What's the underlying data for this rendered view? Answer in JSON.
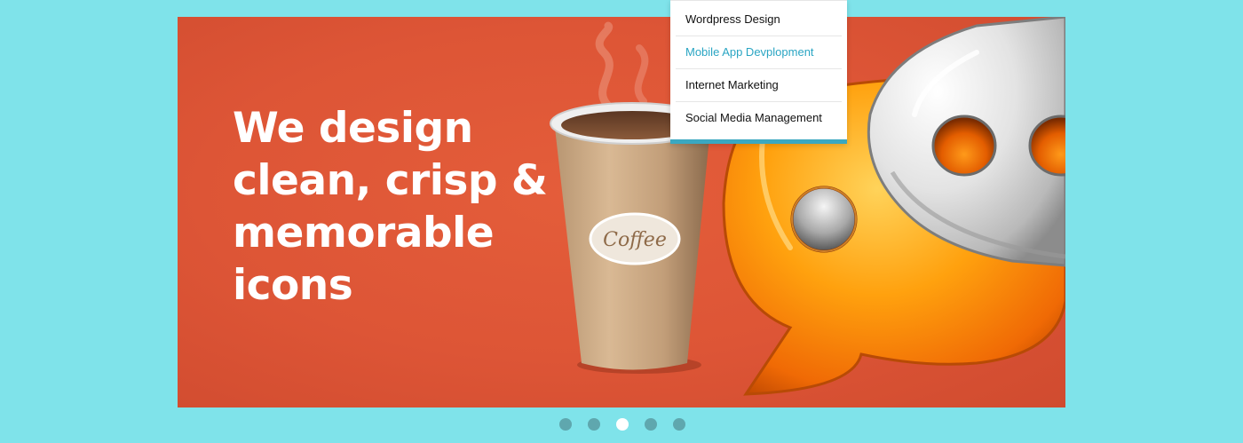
{
  "slider": {
    "headline_lines": [
      "We design",
      "clean, crisp &",
      "memorable",
      "icons"
    ],
    "coffee_label": "Coffee",
    "background_color": "#dd5536",
    "active_slide_index": 2,
    "slide_count": 5
  },
  "menu": {
    "items": [
      {
        "label": "Wordpress Design"
      },
      {
        "label": "Mobile App Devplopment"
      },
      {
        "label": "Internet Marketing"
      },
      {
        "label": "Social Media Management"
      }
    ],
    "active_item_index": 1,
    "accent_color": "#3aa8c1"
  },
  "colors": {
    "page_background": "#7fe3ea",
    "dot_inactive": "#5fa7ae",
    "dot_active": "#ffffff"
  }
}
